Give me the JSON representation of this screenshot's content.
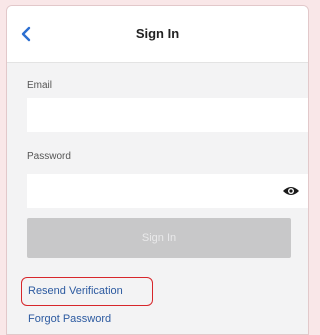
{
  "header": {
    "title": "Sign In",
    "back_icon": "chevron-left-icon"
  },
  "form": {
    "email_label": "Email",
    "email_value": "",
    "password_label": "Password",
    "password_value": "",
    "password_toggle_icon": "eye-icon",
    "submit_label": "Sign In",
    "submit_state": "disabled"
  },
  "links": {
    "resend_verification": "Resend Verification",
    "forgot_password": "Forgot Password"
  },
  "colors": {
    "accent": "#2c5aa0",
    "highlight": "#d7262b",
    "background": "#f9e7e8",
    "button_disabled": "#c8c8c9"
  }
}
